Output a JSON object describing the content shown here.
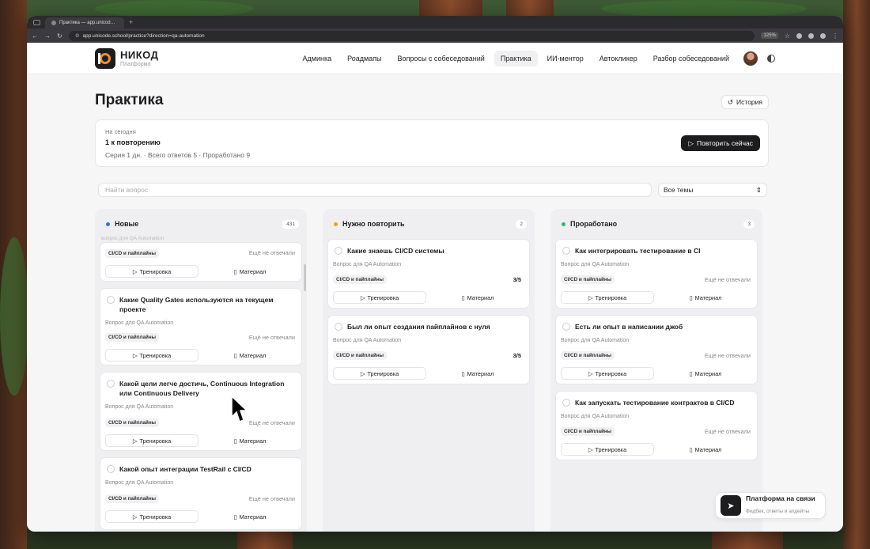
{
  "browser": {
    "tab_title": "Практика — app.unicod…",
    "url": "app.unicode.school/practice?direction=qa-automation",
    "zoom": "125%"
  },
  "brand": {
    "name": "НИКОД",
    "subtitle": "Платформа"
  },
  "nav": [
    "Админка",
    "Роадмапы",
    "Вопросы с собеседований",
    "Практика",
    "ИИ-ментор",
    "Автокликер",
    "Разбор собеседований"
  ],
  "page": {
    "title": "Практика",
    "history": "История"
  },
  "today": {
    "label": "На сегодня",
    "count": "1 к повторению",
    "stats": "Серия 1 дн. · Всего ответов 5 · Проработано 9",
    "repeat": "Повторить сейчас"
  },
  "filters": {
    "search_placeholder": "Найти вопрос",
    "topic": "Все темы"
  },
  "common": {
    "sub": "Вопрос для QA Automation",
    "tag": "CI/CD и пайплайны",
    "status": "Ещё не отвечали",
    "train": "Тренировка",
    "material": "Материал",
    "faded": "вопрос для QA Automation"
  },
  "columns": [
    {
      "title": "Новые",
      "count": "431",
      "color": "#3b6fe0"
    },
    {
      "title": "Нужно повторить",
      "count": "2",
      "color": "#f0a020"
    },
    {
      "title": "Проработано",
      "count": "3",
      "color": "#2eb573"
    }
  ],
  "col1": [
    "Какие Quality Gates используются на текущем проекте",
    "Какой цели легче достичь, Continuous Integration или Continuous Delivery",
    "Какой опыт интеграции TestRail с CI/CD"
  ],
  "col2": [
    "Какие знаешь CI/CD системы",
    "Был ли опыт создания пайплайнов с нуля"
  ],
  "col2_scores": [
    "3/5",
    "3/5"
  ],
  "col3": [
    "Как интегрировать тестирование в CI",
    "Есть ли опыт в написании джоб",
    "Как запускать тестирование контрактов в CI/CD"
  ],
  "feedback": {
    "title": "Платформа на связи",
    "sub": "Фидбек, ответы и апдейты"
  },
  "colors": {
    "accent": "#1d1d1f",
    "logo_ring": "#f28c28"
  }
}
